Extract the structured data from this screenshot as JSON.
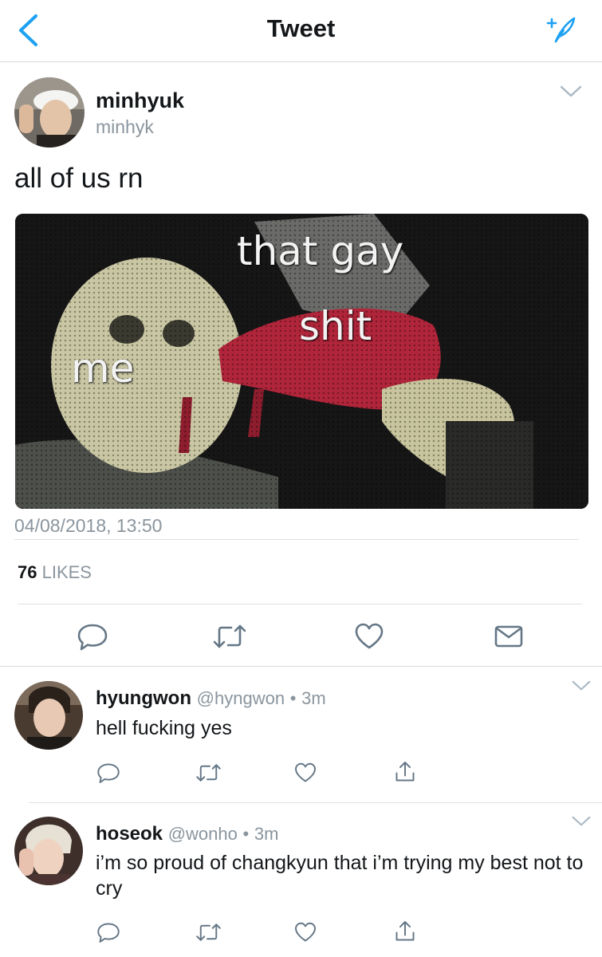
{
  "nav": {
    "title": "Tweet",
    "back_icon": "chevron-left-icon",
    "compose_icon": "compose-tweet-icon",
    "accent_color": "#1da1f2"
  },
  "tweet": {
    "author_name": "minhyuk",
    "author_handle": "minhyk",
    "text": "all of us rn",
    "media": {
      "type": "meme-image",
      "caption_words": [
        "that gay",
        "shit",
        "me"
      ]
    },
    "timestamp": "04/08/2018, 13:50",
    "likes": {
      "count": "76",
      "label": "LIKES"
    },
    "actions": [
      "reply-icon",
      "retweet-icon",
      "like-icon",
      "direct-message-icon"
    ]
  },
  "replies": [
    {
      "name": "hyungwon",
      "handle": "@hyngwon",
      "time": "3m",
      "text": "hell fucking yes",
      "actions": [
        "reply-icon",
        "retweet-icon",
        "like-icon",
        "share-icon"
      ]
    },
    {
      "name": "hoseok",
      "handle": "@wonho",
      "time": "3m",
      "text": "i’m so proud of changkyun that i’m trying my best not to cry",
      "actions": [
        "reply-icon",
        "retweet-icon",
        "like-icon",
        "share-icon"
      ]
    }
  ],
  "separator": "•"
}
